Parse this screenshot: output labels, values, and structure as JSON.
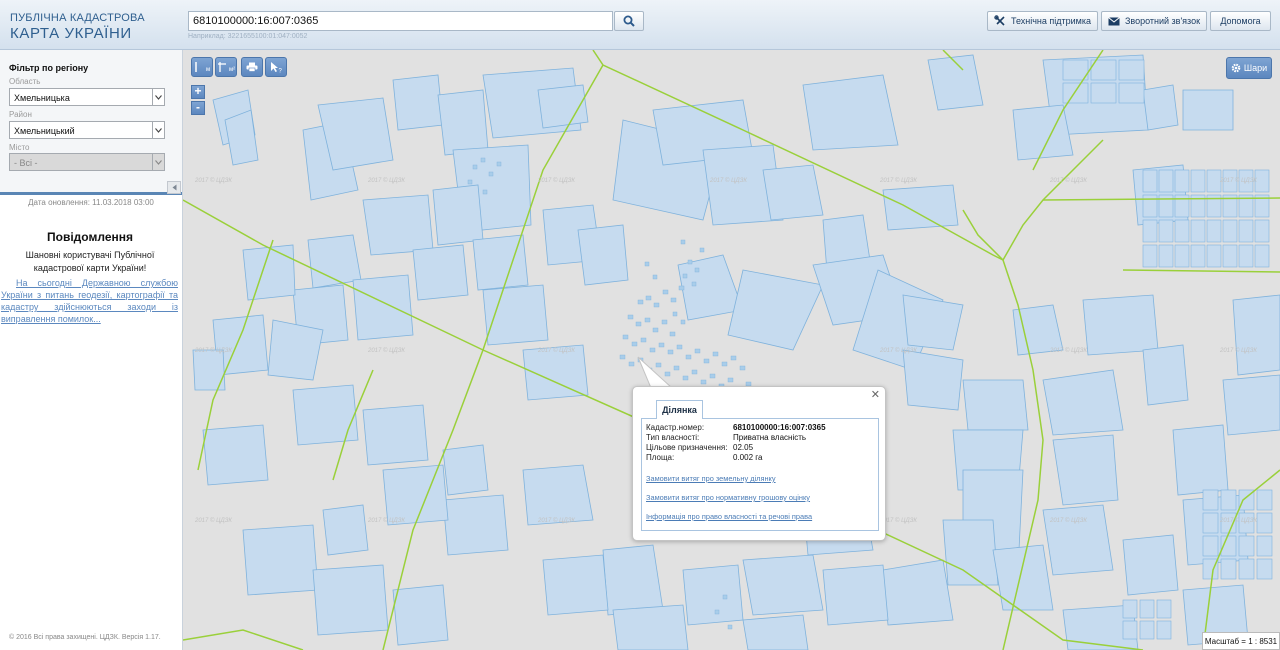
{
  "header": {
    "logo_line1": "ПУБЛІЧНА КАДАСТРОВА",
    "logo_line2": "КАРТА УКРАЇНИ",
    "search_value": "6810100000:16:007:0365",
    "search_hint": "Наприклад: 3221655100:01:047:0052",
    "buttons": {
      "support": "Технічна підтримка",
      "feedback": "Зворотний зв'язок",
      "help": "Допомога"
    }
  },
  "sidebar": {
    "filter_title": "Фільтр по регіону",
    "region_label": "Область",
    "region_value": "Хмельницька",
    "district_label": "Район",
    "district_value": "Хмельницький",
    "city_label": "Місто",
    "city_value": "- Всі -",
    "updated": "Дата оновлення: 11.03.2018 03:00",
    "notice_title": "Повідомлення",
    "notice_text": "Шановні користувачі Публічної кадастрової карти України!",
    "notice_link": "На сьогодні Державною службою України з питань геодезії, картографії та кадастру здійснюються заходи із виправлення помилок...",
    "copyright": "© 2016 Всі права захищені. ЦДЗК. Версія 1.17."
  },
  "map": {
    "layers_label": "Шари",
    "zoom_in": "+",
    "zoom_out": "-",
    "tool_distance_sub": "м",
    "tool_area_sub": "м²",
    "watermark": "2017 © ЦДЗК",
    "scale": "Масштаб = 1 : 8531"
  },
  "popup": {
    "tab": "Ділянка",
    "rows": [
      {
        "label": "Кадастр.номер:",
        "value": "6810100000:16:007:0365"
      },
      {
        "label": "Тип власності:",
        "value": "Приватна власність"
      },
      {
        "label": "Цільове призначення:",
        "value": "02.05"
      },
      {
        "label": "Площа:",
        "value": "0.002 га"
      }
    ],
    "links": [
      "Замовити витяг про земельну ділянку",
      "Замовити витяг про нормативну грошову оцінку",
      "Інформація про право власності та речові права"
    ]
  },
  "colors": {
    "parcel_fill": "#c6dbef",
    "parcel_stroke": "#7fb2dc",
    "boundary": "#9ad03a",
    "tool_button": "#6d96c9",
    "link": "#4b7cb6"
  }
}
